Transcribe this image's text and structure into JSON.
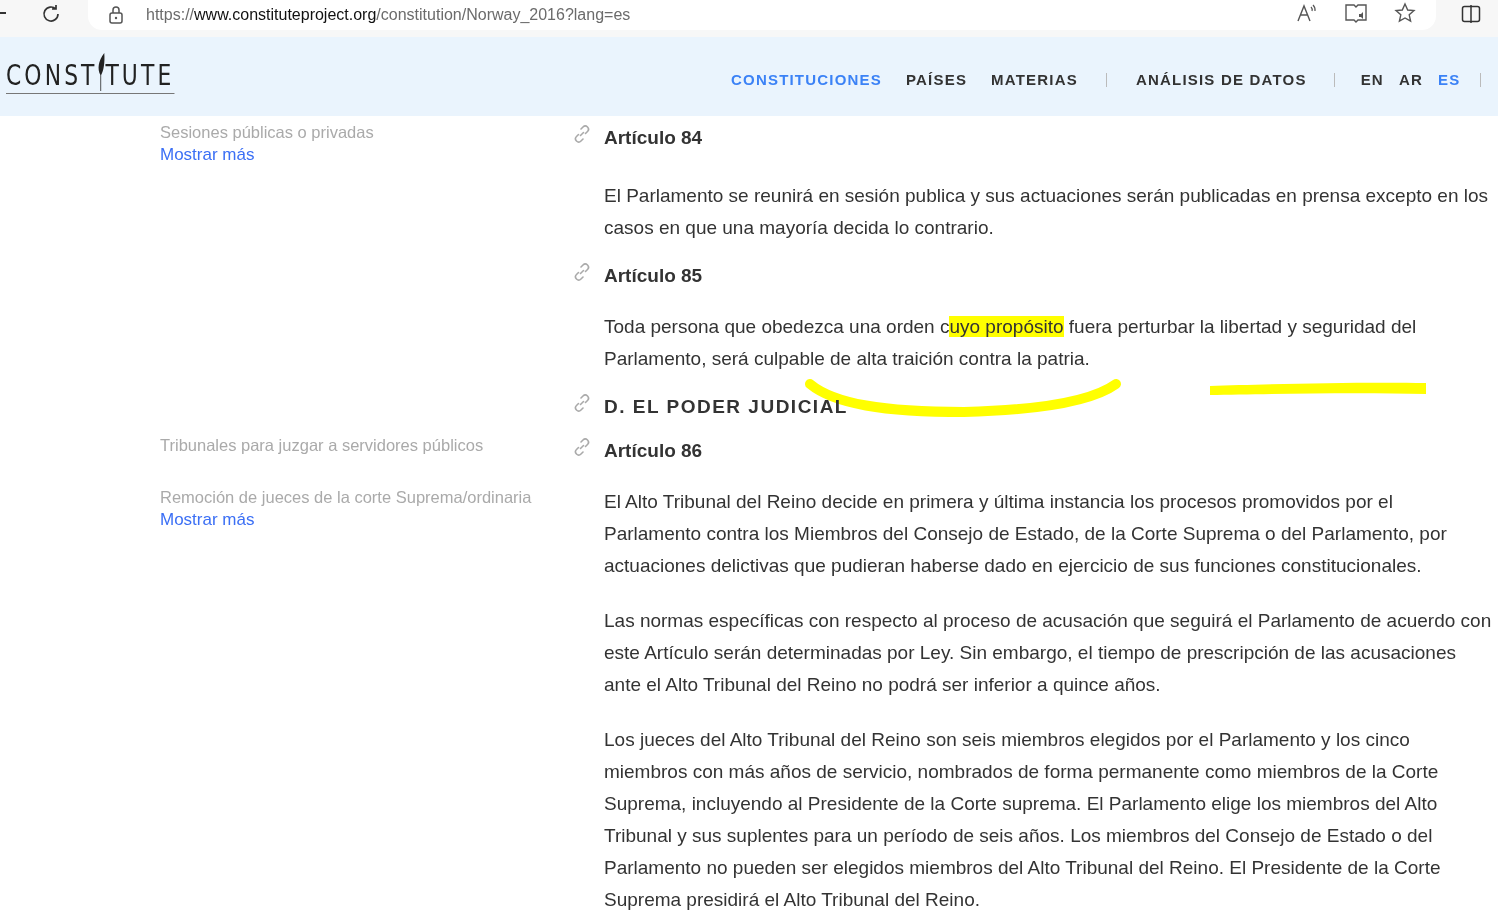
{
  "browser": {
    "url": {
      "scheme": "https://",
      "domain": "www.constituteproject.org",
      "path": "/constitution/Norway_2016?lang=es"
    }
  },
  "site": {
    "logo_left": "CONST",
    "logo_right": "TUTE",
    "nav": [
      {
        "label": "CONSTITUCIONES",
        "selected": true
      },
      {
        "label": "PAÍSES",
        "selected": false
      },
      {
        "label": "MATERIAS",
        "selected": false
      },
      {
        "label": "ANÁLISIS DE DATOS",
        "selected": false
      }
    ],
    "languages": [
      {
        "label": "EN",
        "selected": false
      },
      {
        "label": "AR",
        "selected": false
      },
      {
        "label": "ES",
        "selected": true
      }
    ]
  },
  "rows": [
    {
      "kind": "article",
      "text": "Artículo 84",
      "topic": {
        "label": "Sesiones públicas o privadas",
        "more": "Mostrar más"
      }
    },
    {
      "kind": "paragraph",
      "segments": [
        {
          "text": "El Parlamento se reunirá en sesión publica y sus actuaciones serán publicadas en prensa excepto en los casos en que una mayoría decida lo contrario.",
          "highlighted": false
        }
      ]
    },
    {
      "kind": "article",
      "text": "Artículo 85"
    },
    {
      "kind": "paragraph",
      "annotated": true,
      "segments": [
        {
          "text": "Toda persona que obedezca una orden c",
          "highlighted": false
        },
        {
          "text": "uyo propósito",
          "highlighted": true
        },
        {
          "text": " fuera perturbar la libertad y seguridad del Parlamento, será culpable de alta traición contra la patria.",
          "highlighted": false
        }
      ]
    },
    {
      "kind": "section",
      "text": "D. EL PODER JUDICIAL"
    },
    {
      "kind": "article",
      "text": "Artículo 86",
      "topic": {
        "label": "Tribunales para juzgar a servidores públicos"
      }
    },
    {
      "kind": "paragraph",
      "topic": {
        "label": "Remoción de jueces de la corte Suprema/ordinaria",
        "more": "Mostrar más"
      },
      "segments": [
        {
          "text": "El Alto Tribunal del Reino decide en primera y última instancia los procesos promovidos por el Parlamento contra los Miembros del Consejo de Estado, de la Corte Suprema o del Parlamento, por actuaciones delictivas que pudieran haberse dado en ejercicio de sus funciones constitucionales.",
          "highlighted": false
        }
      ]
    },
    {
      "kind": "paragraph",
      "segments": [
        {
          "text": "Las normas específicas con respecto al proceso de acusación que seguirá el Parlamento de acuerdo con este Artículo serán determinadas por Ley. Sin embargo, el tiempo de prescripción de las acusaciones ante el Alto Tribunal del Reino no podrá ser inferior a quince años.",
          "highlighted": false
        }
      ]
    },
    {
      "kind": "paragraph",
      "segments": [
        {
          "text": "Los jueces del Alto Tribunal del Reino son seis miembros elegidos por el Parlamento y los cinco miembros con más años de servicio, nombrados de forma permanente como miembros de la Corte Suprema, incluyendo al Presidente de la Corte suprema. El Parlamento elige los miembros del Alto Tribunal y sus suplentes para un período de seis años. Los miembros del Consejo de Estado o del Parlamento no pueden ser elegidos miembros del Alto Tribunal del Reino. El Presidente de la Corte Suprema presidirá el Alto Tribunal del Reino.",
          "highlighted": false
        }
      ]
    }
  ]
}
